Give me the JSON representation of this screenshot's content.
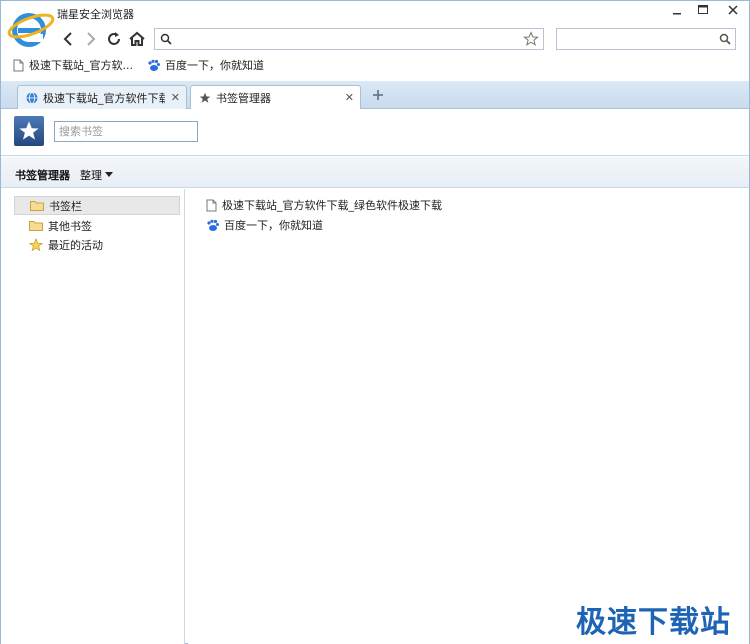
{
  "window": {
    "title": "瑞星安全浏览器"
  },
  "address_bar": {
    "value": "",
    "placeholder": ""
  },
  "search_box": {
    "value": "",
    "placeholder": ""
  },
  "bookmarks_bar": {
    "items": [
      {
        "label": "极速下载站_官方软..."
      },
      {
        "label": "百度一下，你就知道"
      }
    ]
  },
  "tabs": [
    {
      "label": "极速下载站_官方软件下载"
    },
    {
      "label": "书签管理器"
    }
  ],
  "bookmark_manager": {
    "search_placeholder": "搜索书签",
    "toolbar_title": "书签管理器",
    "organize_label": "整理",
    "tree": [
      {
        "label": "书签栏",
        "icon": "folder-icon",
        "selected": true
      },
      {
        "label": "其他书签",
        "icon": "folder-icon"
      },
      {
        "label": "最近的活动",
        "icon": "star-icon"
      }
    ],
    "entries": [
      {
        "label": "极速下载站_官方软件下载_绿色软件极速下载",
        "icon": "page-icon"
      },
      {
        "label": "百度一下，你就知道",
        "icon": "baidu-paw-icon"
      }
    ]
  },
  "watermark": "极速下载站",
  "colors": {
    "accent": "#1d64b5",
    "tab_strip": "#d3e3f3",
    "star_tile": "#2f5a96"
  }
}
